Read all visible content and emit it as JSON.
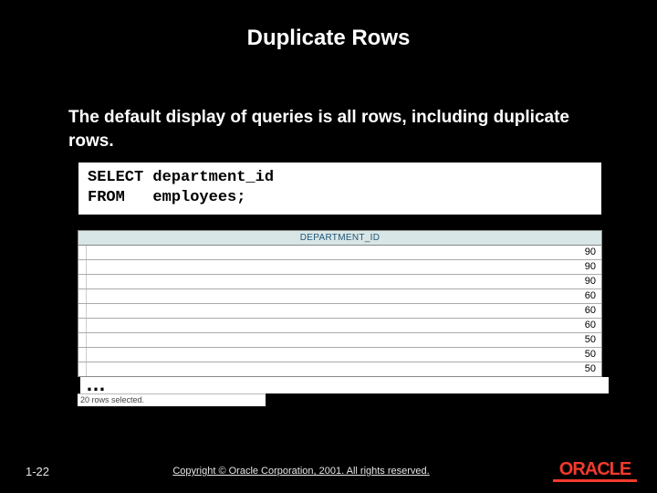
{
  "slide": {
    "title": "Duplicate Rows",
    "subtitle": "The default display of queries is all rows, including duplicate rows.",
    "code": "SELECT department_id\nFROM   employees;",
    "result": {
      "header": "DEPARTMENT_ID",
      "rows": [
        "90",
        "90",
        "90",
        "60",
        "60",
        "60",
        "50",
        "50",
        "50"
      ]
    },
    "ellipsis": "…",
    "rowcount_text": "20 rows selected.",
    "page_number": "1-22",
    "copyright": "Copyright © Oracle Corporation, 2001. All rights reserved.",
    "logo": "ORACLE"
  }
}
